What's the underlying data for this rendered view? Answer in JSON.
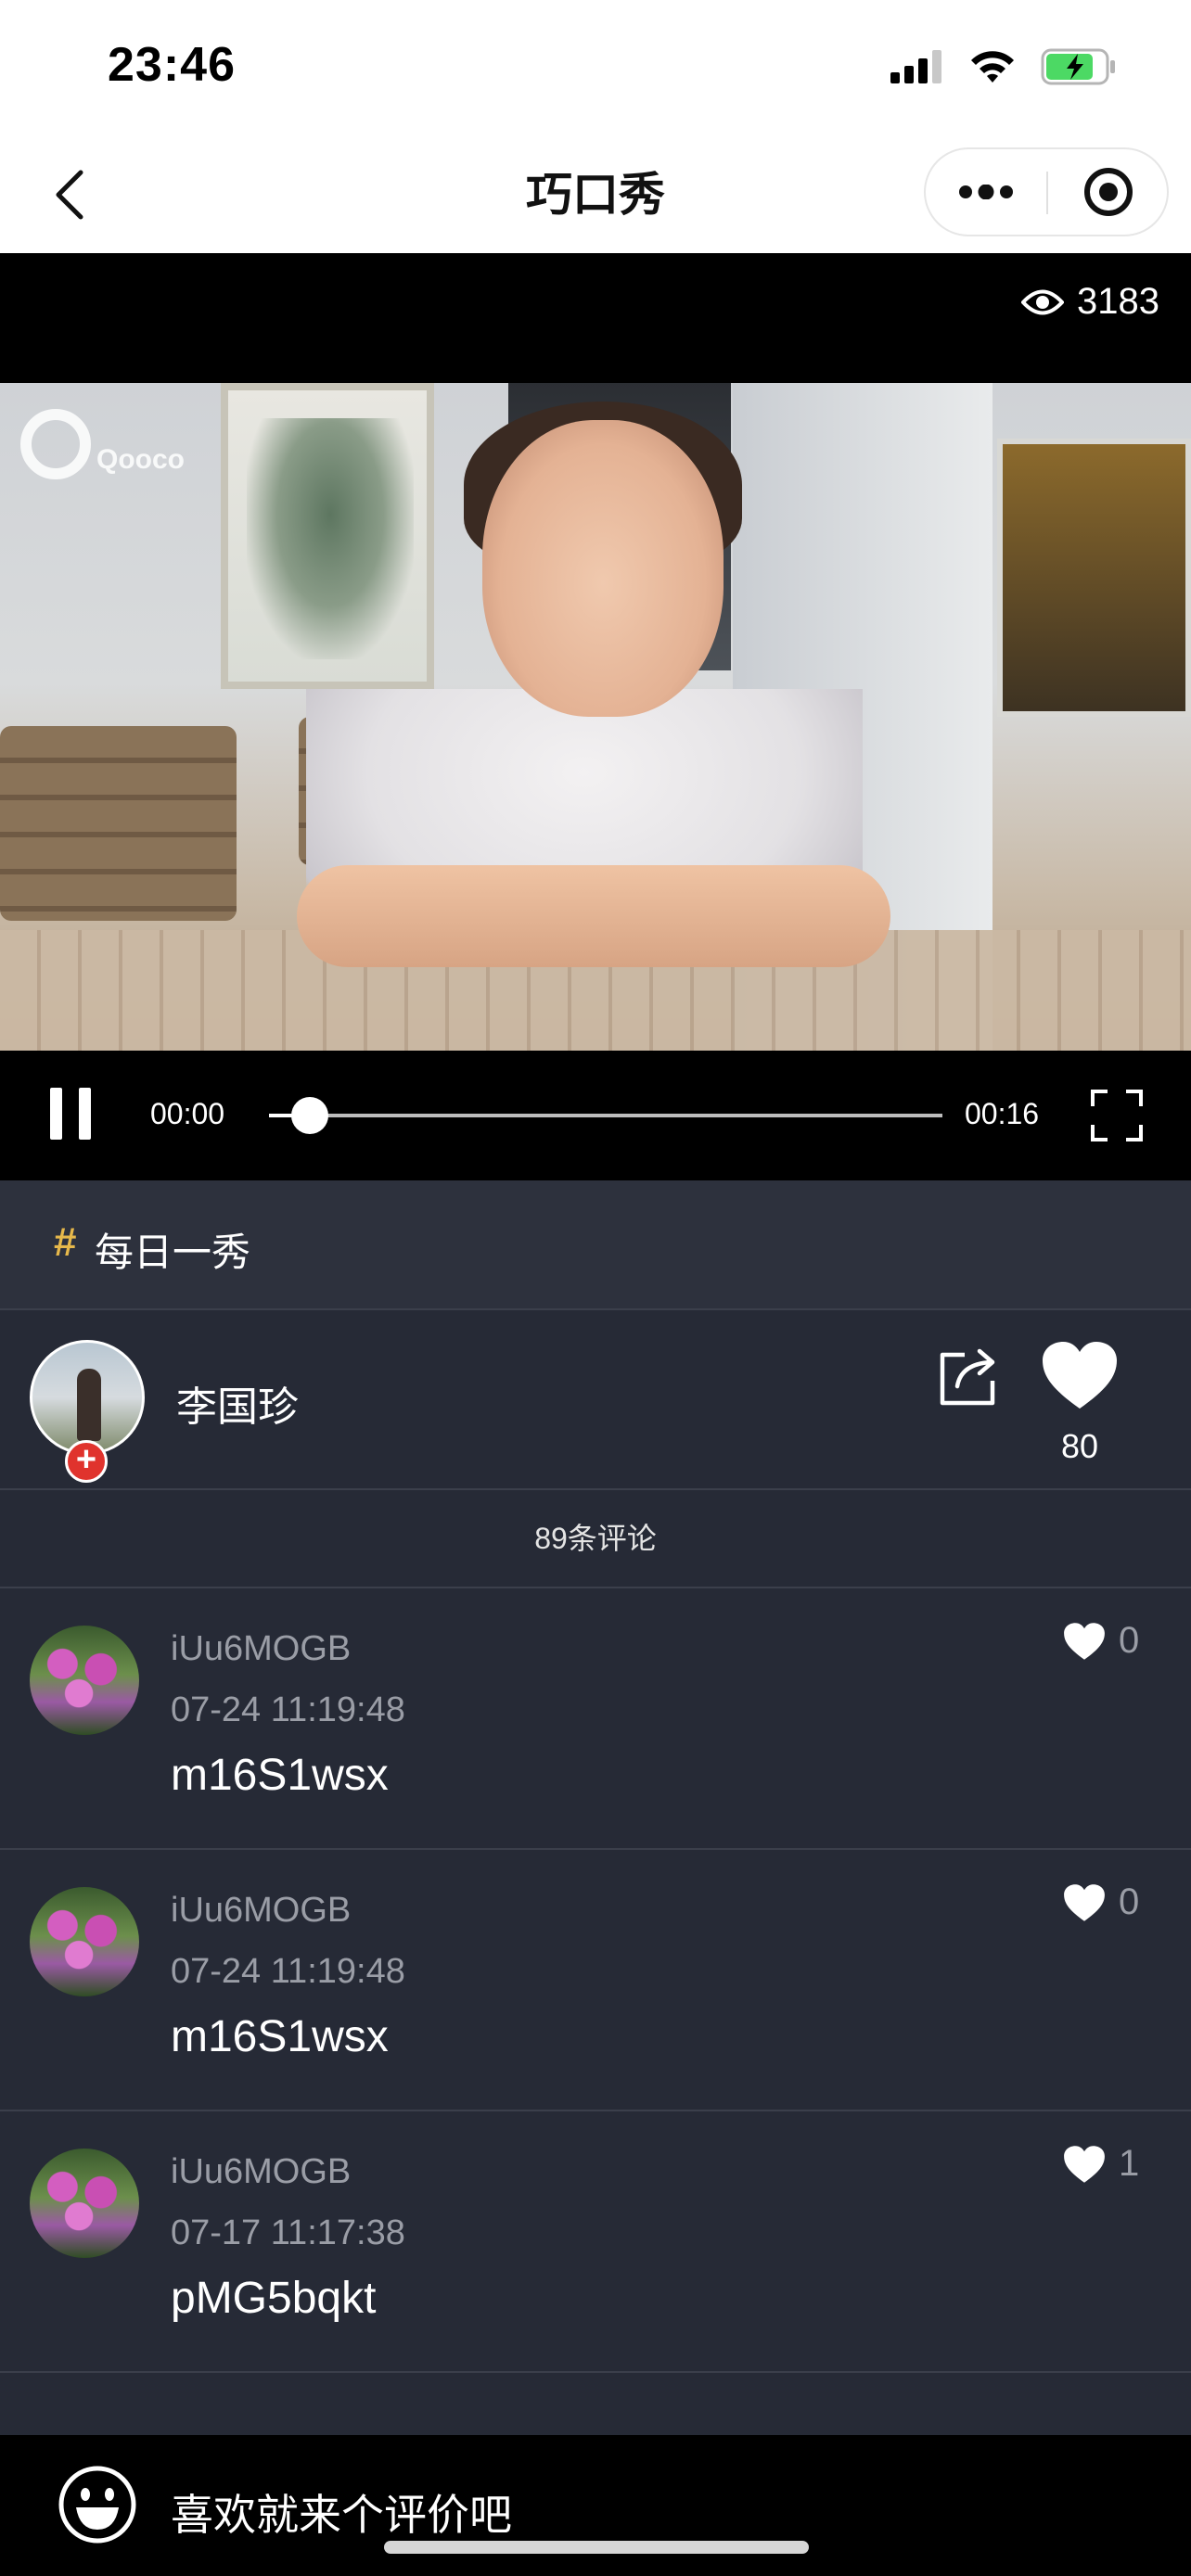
{
  "status_bar": {
    "time": "23:46"
  },
  "nav": {
    "title": "巧口秀"
  },
  "video": {
    "views": "3183",
    "watermark": "Qooco",
    "current_time": "00:00",
    "duration": "00:16",
    "progress_fraction": 0.06
  },
  "topic": {
    "hash": "#",
    "label": "每日一秀"
  },
  "author": {
    "name": "李国珍",
    "likes": "80",
    "follow_symbol": "+"
  },
  "comments_header": {
    "label": "89条评论"
  },
  "comments": [
    {
      "user": "iUu6MOGB",
      "time": "07-24 11:19:48",
      "text": "m16S1wsx",
      "likes": "0"
    },
    {
      "user": "iUu6MOGB",
      "time": "07-24 11:19:48",
      "text": "m16S1wsx",
      "likes": "0"
    },
    {
      "user": "iUu6MOGB",
      "time": "07-17 11:17:38",
      "text": "pMG5bqkt",
      "likes": "1"
    }
  ],
  "input": {
    "placeholder": "喜欢就来个评价吧"
  },
  "colors": {
    "background": "#262a36",
    "topic_hash": "#e6b84b",
    "follow_badge": "#e0332d",
    "battery_green": "#4cd964"
  },
  "icons": [
    "signal-icon",
    "wifi-icon",
    "battery-icon",
    "back-icon",
    "more-icon",
    "close-target-icon",
    "eye-icon",
    "pause-icon",
    "fullscreen-icon",
    "share-icon",
    "heart-icon",
    "emoji-icon"
  ]
}
